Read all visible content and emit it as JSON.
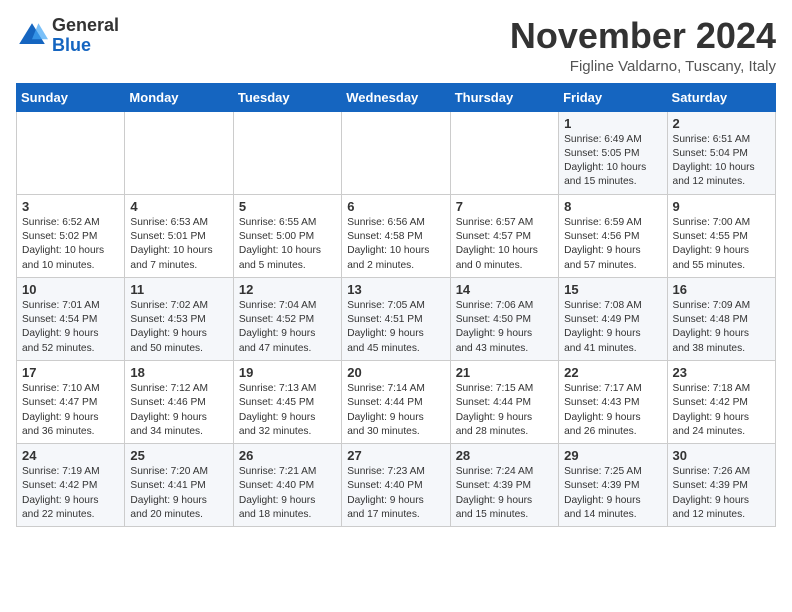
{
  "logo": {
    "general": "General",
    "blue": "Blue"
  },
  "title": "November 2024",
  "subtitle": "Figline Valdarno, Tuscany, Italy",
  "headers": [
    "Sunday",
    "Monday",
    "Tuesday",
    "Wednesday",
    "Thursday",
    "Friday",
    "Saturday"
  ],
  "weeks": [
    [
      {
        "day": "",
        "info": ""
      },
      {
        "day": "",
        "info": ""
      },
      {
        "day": "",
        "info": ""
      },
      {
        "day": "",
        "info": ""
      },
      {
        "day": "",
        "info": ""
      },
      {
        "day": "1",
        "info": "Sunrise: 6:49 AM\nSunset: 5:05 PM\nDaylight: 10 hours\nand 15 minutes."
      },
      {
        "day": "2",
        "info": "Sunrise: 6:51 AM\nSunset: 5:04 PM\nDaylight: 10 hours\nand 12 minutes."
      }
    ],
    [
      {
        "day": "3",
        "info": "Sunrise: 6:52 AM\nSunset: 5:02 PM\nDaylight: 10 hours\nand 10 minutes."
      },
      {
        "day": "4",
        "info": "Sunrise: 6:53 AM\nSunset: 5:01 PM\nDaylight: 10 hours\nand 7 minutes."
      },
      {
        "day": "5",
        "info": "Sunrise: 6:55 AM\nSunset: 5:00 PM\nDaylight: 10 hours\nand 5 minutes."
      },
      {
        "day": "6",
        "info": "Sunrise: 6:56 AM\nSunset: 4:58 PM\nDaylight: 10 hours\nand 2 minutes."
      },
      {
        "day": "7",
        "info": "Sunrise: 6:57 AM\nSunset: 4:57 PM\nDaylight: 10 hours\nand 0 minutes."
      },
      {
        "day": "8",
        "info": "Sunrise: 6:59 AM\nSunset: 4:56 PM\nDaylight: 9 hours\nand 57 minutes."
      },
      {
        "day": "9",
        "info": "Sunrise: 7:00 AM\nSunset: 4:55 PM\nDaylight: 9 hours\nand 55 minutes."
      }
    ],
    [
      {
        "day": "10",
        "info": "Sunrise: 7:01 AM\nSunset: 4:54 PM\nDaylight: 9 hours\nand 52 minutes."
      },
      {
        "day": "11",
        "info": "Sunrise: 7:02 AM\nSunset: 4:53 PM\nDaylight: 9 hours\nand 50 minutes."
      },
      {
        "day": "12",
        "info": "Sunrise: 7:04 AM\nSunset: 4:52 PM\nDaylight: 9 hours\nand 47 minutes."
      },
      {
        "day": "13",
        "info": "Sunrise: 7:05 AM\nSunset: 4:51 PM\nDaylight: 9 hours\nand 45 minutes."
      },
      {
        "day": "14",
        "info": "Sunrise: 7:06 AM\nSunset: 4:50 PM\nDaylight: 9 hours\nand 43 minutes."
      },
      {
        "day": "15",
        "info": "Sunrise: 7:08 AM\nSunset: 4:49 PM\nDaylight: 9 hours\nand 41 minutes."
      },
      {
        "day": "16",
        "info": "Sunrise: 7:09 AM\nSunset: 4:48 PM\nDaylight: 9 hours\nand 38 minutes."
      }
    ],
    [
      {
        "day": "17",
        "info": "Sunrise: 7:10 AM\nSunset: 4:47 PM\nDaylight: 9 hours\nand 36 minutes."
      },
      {
        "day": "18",
        "info": "Sunrise: 7:12 AM\nSunset: 4:46 PM\nDaylight: 9 hours\nand 34 minutes."
      },
      {
        "day": "19",
        "info": "Sunrise: 7:13 AM\nSunset: 4:45 PM\nDaylight: 9 hours\nand 32 minutes."
      },
      {
        "day": "20",
        "info": "Sunrise: 7:14 AM\nSunset: 4:44 PM\nDaylight: 9 hours\nand 30 minutes."
      },
      {
        "day": "21",
        "info": "Sunrise: 7:15 AM\nSunset: 4:44 PM\nDaylight: 9 hours\nand 28 minutes."
      },
      {
        "day": "22",
        "info": "Sunrise: 7:17 AM\nSunset: 4:43 PM\nDaylight: 9 hours\nand 26 minutes."
      },
      {
        "day": "23",
        "info": "Sunrise: 7:18 AM\nSunset: 4:42 PM\nDaylight: 9 hours\nand 24 minutes."
      }
    ],
    [
      {
        "day": "24",
        "info": "Sunrise: 7:19 AM\nSunset: 4:42 PM\nDaylight: 9 hours\nand 22 minutes."
      },
      {
        "day": "25",
        "info": "Sunrise: 7:20 AM\nSunset: 4:41 PM\nDaylight: 9 hours\nand 20 minutes."
      },
      {
        "day": "26",
        "info": "Sunrise: 7:21 AM\nSunset: 4:40 PM\nDaylight: 9 hours\nand 18 minutes."
      },
      {
        "day": "27",
        "info": "Sunrise: 7:23 AM\nSunset: 4:40 PM\nDaylight: 9 hours\nand 17 minutes."
      },
      {
        "day": "28",
        "info": "Sunrise: 7:24 AM\nSunset: 4:39 PM\nDaylight: 9 hours\nand 15 minutes."
      },
      {
        "day": "29",
        "info": "Sunrise: 7:25 AM\nSunset: 4:39 PM\nDaylight: 9 hours\nand 14 minutes."
      },
      {
        "day": "30",
        "info": "Sunrise: 7:26 AM\nSunset: 4:39 PM\nDaylight: 9 hours\nand 12 minutes."
      }
    ]
  ]
}
